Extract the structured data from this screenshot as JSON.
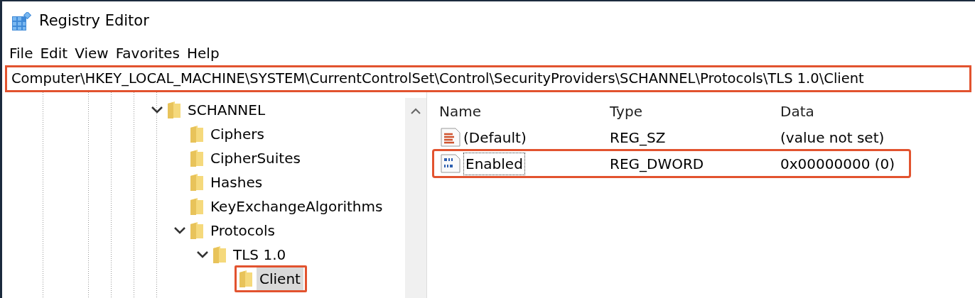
{
  "window": {
    "title": "Registry Editor"
  },
  "menu": [
    "File",
    "Edit",
    "View",
    "Favorites",
    "Help"
  ],
  "address_bar": {
    "value": "Computer\\HKEY_LOCAL_MACHINE\\SYSTEM\\CurrentControlSet\\Control\\SecurityProviders\\SCHANNEL\\Protocols\\TLS 1.0\\Client",
    "highlighted": true
  },
  "tree": [
    {
      "label": "SCHANNEL",
      "expanded": true,
      "selected": false,
      "highlighted": false,
      "children": [
        {
          "label": "Ciphers",
          "selected": false,
          "highlighted": false
        },
        {
          "label": "CipherSuites",
          "selected": false,
          "highlighted": false
        },
        {
          "label": "Hashes",
          "selected": false,
          "highlighted": false
        },
        {
          "label": "KeyExchangeAlgorithms",
          "selected": false,
          "highlighted": false
        },
        {
          "label": "Protocols",
          "expanded": true,
          "selected": false,
          "highlighted": false,
          "children": [
            {
              "label": "TLS 1.0",
              "expanded": true,
              "selected": false,
              "highlighted": false,
              "children": [
                {
                  "label": "Client",
                  "selected": true,
                  "highlighted": true
                }
              ]
            }
          ]
        }
      ]
    }
  ],
  "table": {
    "columns": [
      "Name",
      "Type",
      "Data"
    ],
    "rows": [
      {
        "kind": "string",
        "name": "(Default)",
        "type": "REG_SZ",
        "data": "(value not set)",
        "focused": false,
        "highlighted": false
      },
      {
        "kind": "binary",
        "name": "Enabled",
        "type": "REG_DWORD",
        "data": "0x00000000 (0)",
        "focused": true,
        "highlighted": true
      }
    ]
  }
}
